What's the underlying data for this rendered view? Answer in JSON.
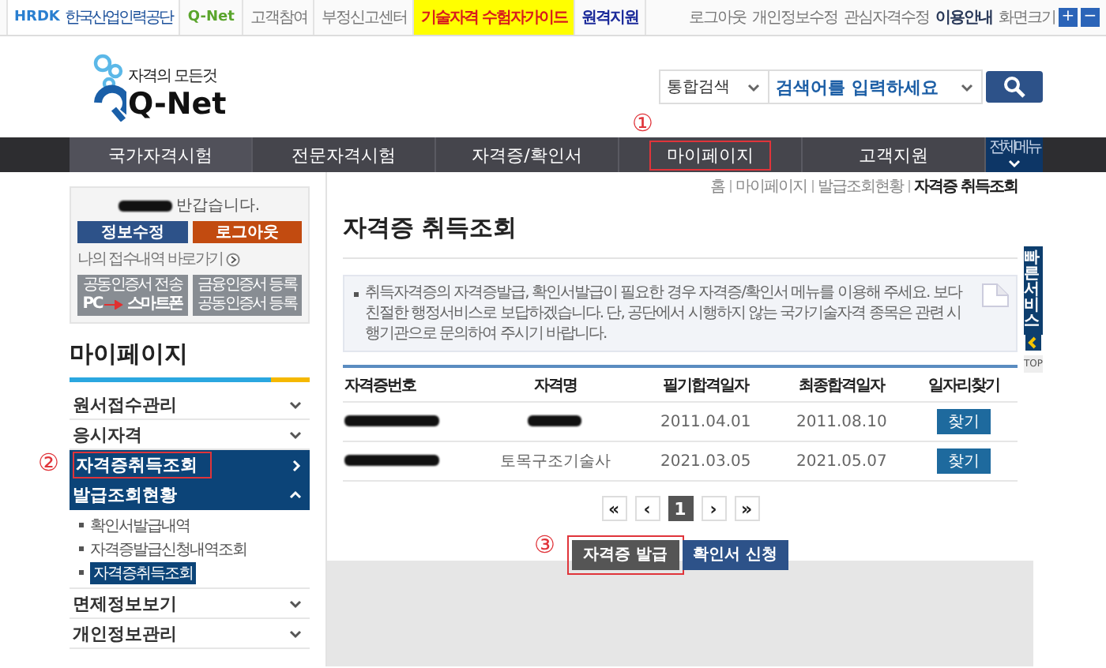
{
  "top_bar": {
    "org_logo": {
      "name": "HRDK",
      "subtitle": "한국산업인력공단"
    },
    "site_logo": "Q-Net",
    "links": [
      {
        "label": "고객참여",
        "kind": "plain"
      },
      {
        "label": "부정신고센터",
        "kind": "plain"
      },
      {
        "label": "기술자격 수험자가이드",
        "kind": "featured"
      },
      {
        "label": "원격지원",
        "kind": "strong"
      }
    ],
    "user_links": [
      {
        "label": "로그아웃",
        "bold": false
      },
      {
        "label": "개인정보수정",
        "bold": false
      },
      {
        "label": "관심자격수정",
        "bold": false
      },
      {
        "label": "이용안내",
        "bold": true
      }
    ],
    "font_size": {
      "label": "화면크기",
      "buttons": [
        "+",
        "−"
      ]
    }
  },
  "header": {
    "logo": {
      "tagline": "자격의 모든것",
      "name": "Q-Net"
    },
    "search": {
      "scope": "통합검색",
      "placeholder": "검색어를 입력하세요"
    }
  },
  "nav": {
    "items": [
      {
        "label": "국가자격시험",
        "selected": true,
        "highlighted": false
      },
      {
        "label": "전문자격시험",
        "selected": false,
        "highlighted": false
      },
      {
        "label": "자격증/확인서",
        "selected": false,
        "highlighted": false
      },
      {
        "label": "마이페이지",
        "selected": false,
        "highlighted": true,
        "marker": "①"
      },
      {
        "label": "고객지원",
        "selected": false,
        "highlighted": false
      }
    ],
    "all_menu": "전체메뉴"
  },
  "breadcrumb": [
    {
      "label": "홈",
      "current": false
    },
    {
      "label": "마이페이지",
      "current": false
    },
    {
      "label": "발급조회현황",
      "current": false
    },
    {
      "label": "자격증 취득조회",
      "current": true
    }
  ],
  "login_box": {
    "greeting": "반갑습니다.",
    "buttons": [
      {
        "label": "정보수정",
        "kind": "primary"
      },
      {
        "label": "로그아웃",
        "kind": "danger"
      }
    ],
    "shortcut": "나의 접수내역 바로가기",
    "cert_buttons": [
      {
        "kind": "transfer",
        "title": "공동인증서 전송",
        "from": "PC",
        "to": "스마트폰"
      },
      {
        "kind": "two_line",
        "title": "금융인증서 등록",
        "subtitle": "공동인증서 등록"
      }
    ]
  },
  "sidebar": {
    "title": "마이페이지",
    "items": [
      {
        "label": "원서접수관리",
        "kind": "group",
        "selected": false,
        "expanded": false,
        "highlighted": false
      },
      {
        "label": "응시자격",
        "kind": "group",
        "selected": false,
        "expanded": false,
        "highlighted": false
      },
      {
        "label": "자격증취득조회",
        "kind": "link",
        "selected": true,
        "highlighted": true,
        "marker": "②"
      },
      {
        "label": "발급조회현황",
        "kind": "group",
        "selected": true,
        "expanded": true,
        "highlighted": false,
        "children": [
          {
            "label": "확인서발급내역",
            "selected": false
          },
          {
            "label": "자격증발급신청내역조회",
            "selected": false
          },
          {
            "label": "자격증취득조회",
            "selected": true
          }
        ]
      },
      {
        "label": "면제정보보기",
        "kind": "group",
        "selected": false,
        "expanded": false,
        "highlighted": false
      },
      {
        "label": "개인정보관리",
        "kind": "group",
        "selected": false,
        "expanded": false,
        "highlighted": false
      }
    ]
  },
  "main": {
    "title": "자격증 취득조회",
    "notice": "취득자격증의 자격증발급, 확인서발급이 필요한 경우 자격증/확인서 메뉴를 이용해 주세요. 보다 친절한 행정서비스로 보답하겠습니다. 단, 공단에서 시행하지 않는 국가기술자격 종목은 관련 시행기관으로 문의하여 주시기 바랍니다.",
    "table": {
      "columns": [
        "자격증번호",
        "자격명",
        "필기합격일자",
        "최종합격일자",
        "일자리찾기"
      ],
      "rows": [
        {
          "cells": [
            {
              "kind": "redacted"
            },
            {
              "kind": "redacted"
            },
            {
              "kind": "text",
              "text": "2011.04.01"
            },
            {
              "kind": "text",
              "text": "2011.08.10"
            },
            {
              "kind": "button",
              "text": "찾기"
            }
          ]
        },
        {
          "cells": [
            {
              "kind": "redacted"
            },
            {
              "kind": "text",
              "text": "토목구조기술사"
            },
            {
              "kind": "text",
              "text": "2021.03.05"
            },
            {
              "kind": "text",
              "text": "2021.05.07"
            },
            {
              "kind": "button",
              "text": "찾기"
            }
          ]
        }
      ]
    },
    "pagination": [
      {
        "label": "«",
        "selected": false
      },
      {
        "label": "‹",
        "selected": false
      },
      {
        "label": "1",
        "selected": true
      },
      {
        "label": "›",
        "selected": false
      },
      {
        "label": "»",
        "selected": false
      }
    ],
    "actions": [
      {
        "label": "자격증 발급",
        "kind": "secondary",
        "highlighted": true,
        "marker": "③"
      },
      {
        "label": "확인서 신청",
        "kind": "primary",
        "highlighted": false
      }
    ]
  },
  "quick_menu": {
    "label": "빠른서비스",
    "top": "TOP"
  }
}
